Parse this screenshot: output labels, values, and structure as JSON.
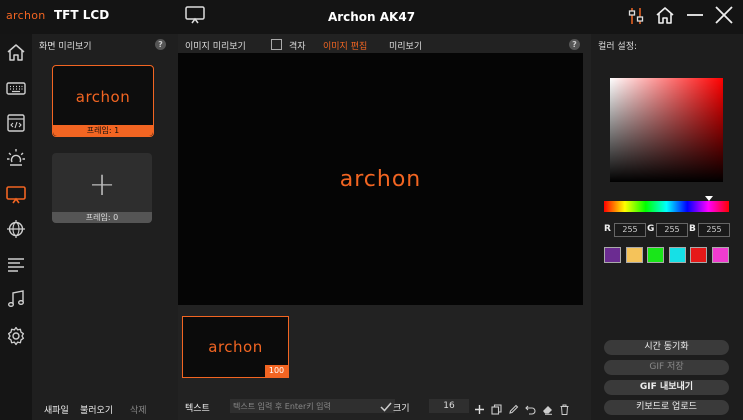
{
  "titlebar": {
    "brand": "archon",
    "module": "TFT LCD",
    "title": "Archon AK47",
    "icons": [
      "monitor-icon",
      "settings-sliders-icon",
      "home-icon",
      "minimize-icon",
      "close-icon"
    ]
  },
  "nav": {
    "icons": [
      "home-icon",
      "keyboard-icon",
      "code-icon",
      "brightness-icon",
      "display-icon",
      "globe-icon",
      "align-icon",
      "music-icon",
      "gear-icon"
    ],
    "active_index": 4
  },
  "screen_preview": {
    "title": "화면 미리보기",
    "help": "?",
    "frames": [
      {
        "logo": "archon",
        "label": "프레임: 1",
        "selected": true
      },
      {
        "label": "프레임: 0",
        "selected": false
      }
    ],
    "add_symbol": "+",
    "actions": {
      "new_file": "새파일",
      "load": "불러오기",
      "delete": "삭제"
    }
  },
  "main": {
    "tabs": {
      "image_preview": "이미지 미리보기",
      "grid": "격자",
      "image_edit": "이미지 편집",
      "preview": "미리보기"
    },
    "help": "?",
    "canvas_logo": "archon",
    "thumbnail": {
      "logo": "archon",
      "badge": "100"
    },
    "bottom": {
      "text_label": "텍스트",
      "text_placeholder": "텍스트 입력 후 Enter키 입력",
      "size_label": "크기",
      "size_value": "16"
    }
  },
  "color_panel": {
    "title": "컬러 설정:",
    "rgb": {
      "r_label": "R",
      "r": "255",
      "g_label": "G",
      "g": "255",
      "b_label": "B",
      "b": "255"
    },
    "swatches": [
      "#6b2c91",
      "#f5c35a",
      "#19e619",
      "#16e0e6",
      "#e61919",
      "#f03ccf"
    ],
    "buttons": {
      "sync_time": "시간 동기화",
      "save_gif": "GIF 저장",
      "export_gif": "GIF 내보내기",
      "upload": "키보드로 업로드"
    }
  },
  "colors": {
    "accent": "#f26522",
    "background": "#1a1a1a"
  }
}
